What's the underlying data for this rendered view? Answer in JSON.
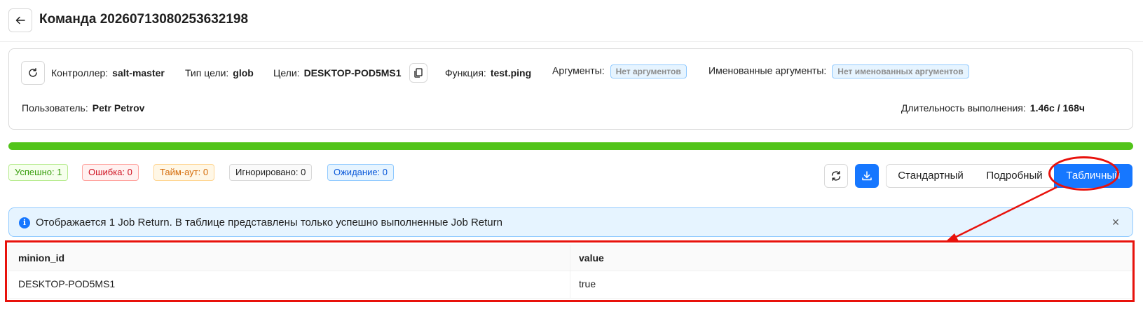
{
  "header": {
    "title": "Команда 20260713080253632198"
  },
  "job_info": {
    "controller_label": "Контроллер:",
    "controller_value": "salt-master",
    "target_type_label": "Тип цели:",
    "target_type_value": "glob",
    "targets_label": "Цели:",
    "targets_value": "DESKTOP-POD5MS1",
    "function_label": "Функция:",
    "function_value": "test.ping",
    "args_label": "Аргументы:",
    "args_value": "Нет аргументов",
    "kwargs_label": "Именованные аргументы:",
    "kwargs_value": "Нет именованных аргументов",
    "user_label": "Пользователь:",
    "user_value": "Petr Petrov",
    "duration_label": "Длительность выполнения:",
    "duration_value": "1.46с / 168ч"
  },
  "progress": {
    "percent": 100,
    "color": "#52c41a"
  },
  "stats": {
    "success": "Успешно: 1",
    "error": "Ошибка: 0",
    "timeout": "Тайм-аут: 0",
    "ignored": "Игнорировано: 0",
    "waiting": "Ожидание: 0"
  },
  "view_modes": {
    "standard": "Стандартный",
    "detailed": "Подробный",
    "table": "Табличный",
    "active": "table"
  },
  "alert": {
    "text": "Отображается 1 Job Return. В таблице представлены только успешно выполненные Job Return"
  },
  "table": {
    "columns": [
      "minion_id",
      "value"
    ],
    "rows": [
      [
        "DESKTOP-POD5MS1",
        "true"
      ]
    ]
  },
  "colors": {
    "accent": "#1677ff",
    "annotation": "#e8120c"
  },
  "icons": [
    "arrow-left-icon",
    "refresh-icon",
    "copy-icon",
    "download-icon",
    "info-icon",
    "close-icon"
  ]
}
